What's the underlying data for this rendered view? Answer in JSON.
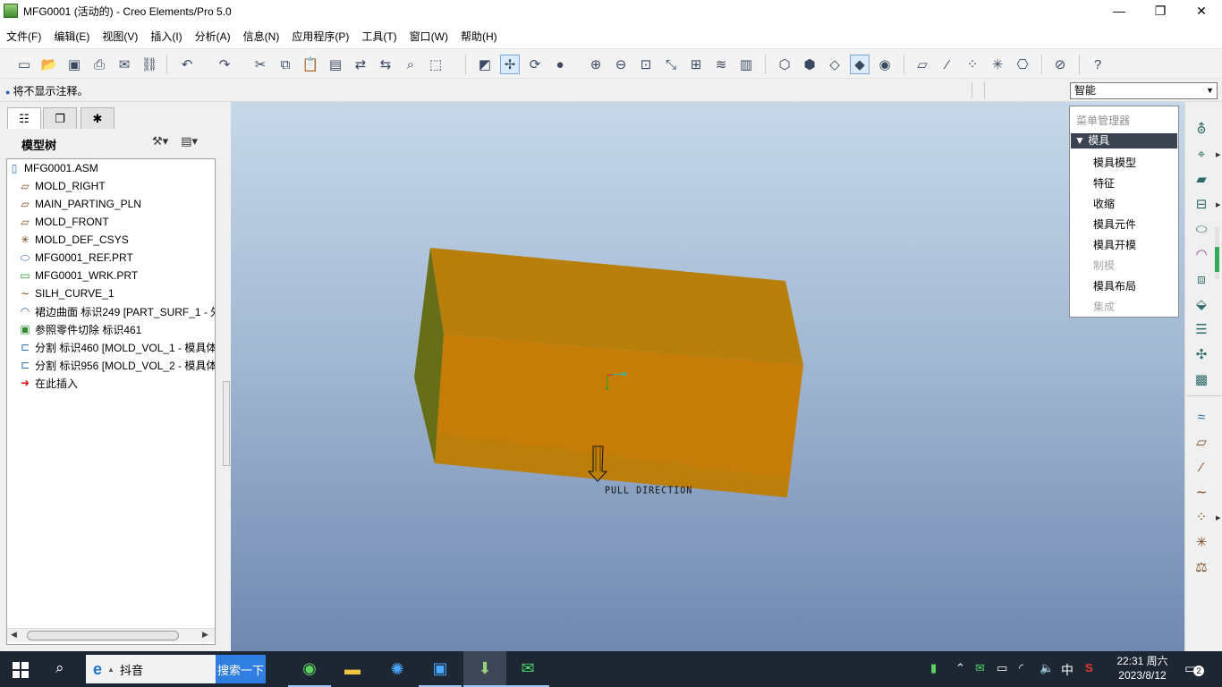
{
  "window": {
    "title": "MFG0001 (活动的) - Creo Elements/Pro 5.0",
    "minimize_glyph": "—",
    "maximize_glyph": "❐",
    "close_glyph": "✕"
  },
  "menubar": {
    "items": [
      "文件(F)",
      "编辑(E)",
      "视图(V)",
      "插入(I)",
      "分析(A)",
      "信息(N)",
      "应用程序(P)",
      "工具(T)",
      "窗口(W)",
      "帮助(H)"
    ]
  },
  "toolbar": {
    "icons": [
      "new-icon",
      "open-icon",
      "save-icon",
      "print-icon",
      "send-mail-icon",
      "send-link-icon",
      "undo-icon",
      "redo-icon",
      "cut-icon",
      "copy-icon",
      "paste-icon",
      "paste-special-icon",
      "regenerate-icon",
      "regen-manager-icon",
      "find-icon",
      "select-box-icon",
      "redraw-icon",
      "spin-center-icon",
      "orient-mode-icon",
      "shade-sphere-icon",
      "zoom-in-icon",
      "zoom-out-icon",
      "refit-icon",
      "reorient-icon",
      "saved-views-icon",
      "layers-icon",
      "view-manager-icon",
      "wireframe-icon",
      "hidden-line-icon",
      "no-hidden-icon",
      "shading-icon",
      "enhanced-realism-icon",
      "datum-planes-icon",
      "datum-axes-icon",
      "datum-points-icon",
      "coord-sys-icon",
      "annotations-icon",
      "hide-icon",
      "context-help-icon"
    ],
    "active": [
      "spin-center-icon",
      "shading-icon"
    ]
  },
  "message_bar": {
    "message": "将不显示注释。",
    "filter_value": "智能"
  },
  "left_panel": {
    "tabs": [
      "model-tree-tab-icon",
      "layer-tree-tab-icon",
      "favorites-tab-icon"
    ],
    "header": "模型树",
    "tree": [
      {
        "label": "MFG0001.ASM",
        "icon": "assembly-icon"
      },
      {
        "label": "MOLD_RIGHT",
        "icon": "datum-plane-icon"
      },
      {
        "label": "MAIN_PARTING_PLN",
        "icon": "datum-plane-icon"
      },
      {
        "label": "MOLD_FRONT",
        "icon": "datum-plane-icon"
      },
      {
        "label": "MOLD_DEF_CSYS",
        "icon": "coordinate-system-icon"
      },
      {
        "label": "MFG0001_REF.PRT",
        "icon": "reference-part-icon"
      },
      {
        "label": "MFG0001_WRK.PRT",
        "icon": "workpiece-icon"
      },
      {
        "label": "SILH_CURVE_1",
        "icon": "silhouette-curve-icon"
      },
      {
        "label": "裙边曲面 标识249 [PART_SURF_1 - 外",
        "icon": "skirt-surface-icon"
      },
      {
        "label": "参照零件切除 标识461",
        "icon": "reference-cut-icon"
      },
      {
        "label": "分割 标识460 [MOLD_VOL_1 - 模具体",
        "icon": "split-icon"
      },
      {
        "label": "分割 标识956 [MOLD_VOL_2 - 模具体",
        "icon": "split-icon"
      },
      {
        "label": "在此插入",
        "icon": "insert-here-arrow-icon"
      }
    ]
  },
  "viewport": {
    "annotation": "PULL DIRECTION",
    "colors": {
      "body": "#c67d07",
      "hatch": "#6a8a1a",
      "sky_top": "#c6d8e9",
      "sky_bottom": "#6f88b0"
    }
  },
  "menu_manager": {
    "title": "菜单管理器",
    "section": "模具",
    "items": [
      {
        "label": "模具模型",
        "enabled": true
      },
      {
        "label": "特征",
        "enabled": true
      },
      {
        "label": "收缩",
        "enabled": true
      },
      {
        "label": "模具元件",
        "enabled": true
      },
      {
        "label": "模具开模",
        "enabled": true
      },
      {
        "label": "制模",
        "enabled": false
      },
      {
        "label": "模具布局",
        "enabled": true
      },
      {
        "label": "集成",
        "enabled": false
      }
    ]
  },
  "right_toolbar": {
    "icons": [
      "mold-reference-model-icon",
      "mold-layout-icon",
      "workpiece-create-icon",
      "shrinkage-icon",
      "parting-surface-icon",
      "skirt-surface-icon",
      "volume-split-icon",
      "mold-component-icon",
      "mold-open-icon",
      "runner-icon",
      "water-line-icon",
      "datum-curve-sketch-icon",
      "datum-plane-icon",
      "datum-axis-icon",
      "datum-curve-icon",
      "datum-point-icon",
      "coordinate-system-icon",
      "analysis-feature-icon"
    ]
  },
  "taskbar": {
    "search_text": "抖音",
    "search_button": "搜索一下",
    "apps": [
      "360-browser-icon",
      "file-explorer-icon",
      "network-tool-icon",
      "window-app-icon",
      "creo-app-icon",
      "wechat-icon"
    ],
    "tray": [
      "battery-app-icon",
      "show-hidden-icons-icon",
      "wechat-tray-icon",
      "power-icon",
      "wifi-icon",
      "volume-icon",
      "ime-icon",
      "sogou-icon"
    ],
    "ime_label": "中",
    "time": "22:31 周六",
    "date": "2023/8/12",
    "notification_count": "2"
  }
}
